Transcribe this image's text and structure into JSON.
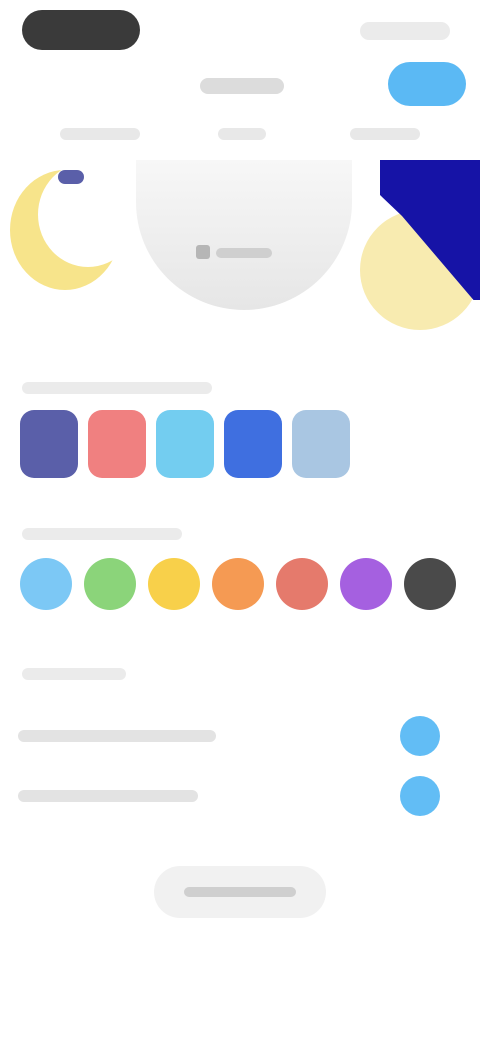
{
  "status_bar": {},
  "header": {
    "done_color": "#5bb9f4"
  },
  "theme_swatches": [
    {
      "name": "theme-swatch-indigo",
      "color": "#5a5fa9"
    },
    {
      "name": "theme-swatch-red",
      "color": "#f08080"
    },
    {
      "name": "theme-swatch-sky",
      "color": "#73cdf0"
    },
    {
      "name": "theme-swatch-blue",
      "color": "#3f6fe0"
    },
    {
      "name": "theme-swatch-steel",
      "color": "#a9c6e2"
    }
  ],
  "accent_swatches": [
    {
      "name": "accent-swatch-blue",
      "color": "#7cc8f5"
    },
    {
      "name": "accent-swatch-green",
      "color": "#8bd47a"
    },
    {
      "name": "accent-swatch-yellow",
      "color": "#f8d04a"
    },
    {
      "name": "accent-swatch-orange",
      "color": "#f59a53"
    },
    {
      "name": "accent-swatch-red",
      "color": "#e57a6c"
    },
    {
      "name": "accent-swatch-purple",
      "color": "#a560e0"
    },
    {
      "name": "accent-swatch-dark",
      "color": "#4a4a4a"
    }
  ],
  "settings": [
    {
      "name": "setting-row-1",
      "toggle_color": "#62bdf5"
    },
    {
      "name": "setting-row-2",
      "toggle_color": "#62bdf5"
    }
  ],
  "bottom_button": {}
}
